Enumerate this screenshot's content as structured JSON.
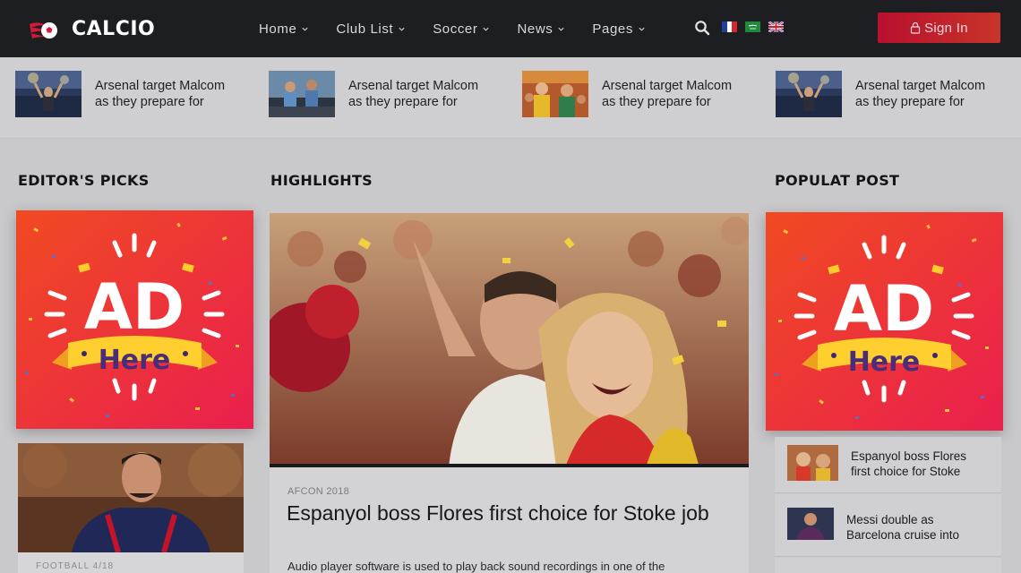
{
  "brand": {
    "name": "CALCIO"
  },
  "nav": {
    "items": [
      {
        "label": "Home"
      },
      {
        "label": "Club List"
      },
      {
        "label": "Soccer"
      },
      {
        "label": "News"
      },
      {
        "label": "Pages"
      }
    ],
    "flags": [
      "france-flag-icon",
      "saudi-arabia-flag-icon",
      "united-kingdom-flag-icon"
    ],
    "signin_label": "Sign In",
    "signin_color": "#c0172c"
  },
  "ticker": {
    "items": [
      {
        "title_line1": "Arsenal target Malcom",
        "title_line2": "as they prepare for"
      },
      {
        "title_line1": "Arsenal target Malcom",
        "title_line2": "as they prepare for"
      },
      {
        "title_line1": "Arsenal target Malcom",
        "title_line2": "as they prepare for"
      },
      {
        "title_line1": "Arsenal target Malcom",
        "title_line2": "as they prepare for"
      }
    ]
  },
  "sections": {
    "editors_picks": "EDITOR'S PICKS",
    "highlights": "HIGHLIGHTS",
    "popular": "POPULAT POST"
  },
  "ad": {
    "big": "AD",
    "small": "Here"
  },
  "editor_card": {
    "category": "FOOTBALL 4/18"
  },
  "highlight": {
    "category": "AFCON 2018",
    "title": "Espanyol boss Flores first choice for Stoke job",
    "description": "Audio player software is used to play back sound recordings in one of the"
  },
  "popular": {
    "items": [
      {
        "line1": "Espanyol boss Flores",
        "line2": "first choice for Stoke"
      },
      {
        "line1": "Messi double as",
        "line2": "Barcelona cruise into"
      }
    ]
  }
}
